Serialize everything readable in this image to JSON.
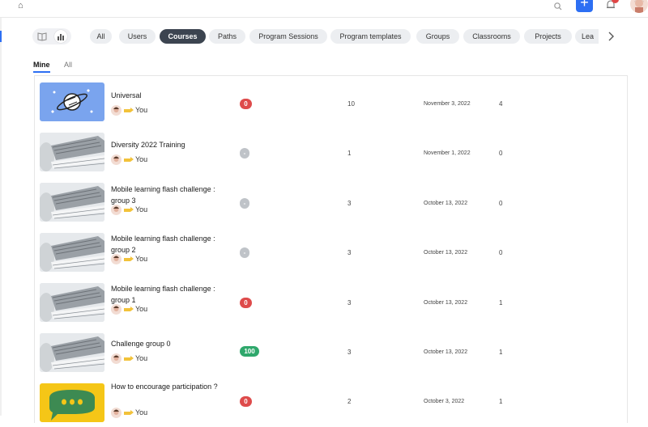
{
  "header": {
    "home_icon": "home-icon",
    "search_icon": "search-icon",
    "add_label": "+",
    "notification_icon": "bell-icon",
    "avatar_icon": "avatar"
  },
  "filters": {
    "chips": [
      "All",
      "Users",
      "Courses",
      "Paths",
      "Program Sessions",
      "Program templates",
      "Groups",
      "Classrooms",
      "Projects",
      "Lea"
    ],
    "active_chip": "Courses"
  },
  "subtabs": [
    {
      "label": "Mine",
      "active": true
    },
    {
      "label": "All",
      "active": false
    }
  ],
  "rows": [
    {
      "title": "Universal",
      "owner": "You",
      "badge": "0",
      "badge_color": "#de4b4b",
      "items": "10",
      "date": "November 3, 2022",
      "count": "4",
      "thumb": "planet"
    },
    {
      "title": "Diversity 2022 Training",
      "owner": "You",
      "badge": "-",
      "badge_color": "#bfc3c8",
      "items": "1",
      "date": "November 1, 2022",
      "count": "0",
      "thumb": "laptop"
    },
    {
      "title": "Mobile learning flash challenge : group 3",
      "owner": "You",
      "badge": "-",
      "badge_color": "#bfc3c8",
      "items": "3",
      "date": "October 13, 2022",
      "count": "0",
      "thumb": "laptop"
    },
    {
      "title": "Mobile learning flash challenge : group 2",
      "owner": "You",
      "badge": "-",
      "badge_color": "#bfc3c8",
      "items": "3",
      "date": "October 13, 2022",
      "count": "0",
      "thumb": "laptop"
    },
    {
      "title": "Mobile learning flash challenge : group 1",
      "owner": "You",
      "badge": "0",
      "badge_color": "#de4b4b",
      "items": "3",
      "date": "October 13, 2022",
      "count": "1",
      "thumb": "laptop"
    },
    {
      "title": "Challenge group 0",
      "owner": "You",
      "badge": "100",
      "badge_color": "#2fa86c",
      "items": "3",
      "date": "October 13, 2022",
      "count": "1",
      "thumb": "laptop"
    },
    {
      "title": "How to encourage participation ?",
      "owner": "You",
      "badge": "0",
      "badge_color": "#de4b4b",
      "items": "2",
      "date": "October 3, 2022",
      "count": "1",
      "thumb": "chat"
    }
  ]
}
